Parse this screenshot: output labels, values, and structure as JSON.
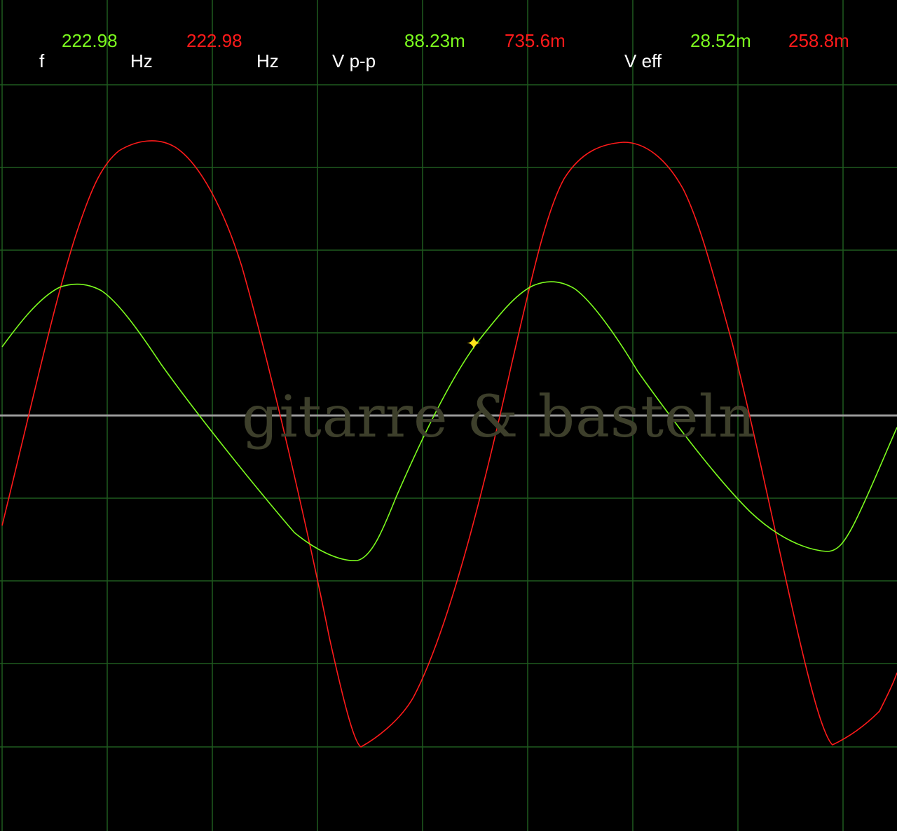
{
  "readout": {
    "f_label": "f",
    "ch1_freq": "222.98",
    "ch1_freq_unit": "Hz",
    "ch2_freq": "222.98",
    "ch2_freq_unit": "Hz",
    "vpp_label": "V p-p",
    "ch1_vpp": "88.23m",
    "ch2_vpp": "735.6m",
    "veff_label": "V eff",
    "ch1_veff": "28.52m",
    "ch2_veff": "258.8m"
  },
  "watermark": "gitarre & basteln",
  "colors": {
    "background": "#000000",
    "grid": "#1f5a1f",
    "baseline": "#9a9a9a",
    "ch1": "#7cfc1e",
    "ch2": "#ff1a1a",
    "cursor": "#ffe11a"
  },
  "cursor_icon": "sparkle-cursor-icon"
}
